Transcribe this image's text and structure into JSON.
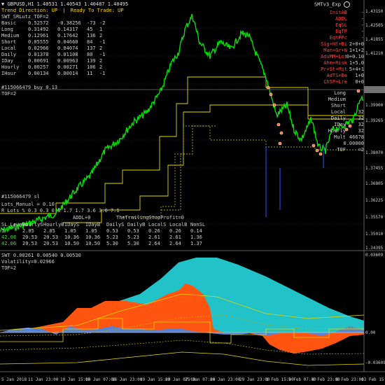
{
  "window": {
    "symbol_line": "GBPUSD,H1  1.40531 1.40543 1.40487 1.40495",
    "expert_label": "SMTv3_Exp",
    "expert_icon": "smiley-icon"
  },
  "status": {
    "trend_direction": "Trend Direction:  UP",
    "ready_to_trade": "Ready To Trade:  UP",
    "separator": "|"
  },
  "left_table": {
    "title": "SWT_SRLutz_TOF=2",
    "rows": [
      {
        "name": "Basic",
        "v1": "0.52572",
        "v2": "-0.38256",
        "v3": "-73",
        "v4": "-2"
      },
      {
        "name": "Long",
        "v1": "0.31492",
        "v2": "0.14317",
        "v3": "45",
        "v4": "1"
      },
      {
        "name": "Medium",
        "v1": "0.12961",
        "v2": "0.17642",
        "v3": "136",
        "v4": "2"
      },
      {
        "name": "Short",
        "v1": "0.05555",
        "v2": "0.04660",
        "v3": "84",
        "v4": "-1"
      },
      {
        "name": "Local",
        "v1": "0.02966",
        "v2": "0.04074",
        "v3": "137",
        "v4": "2"
      },
      {
        "name": "Daily",
        "v1": "0.01378",
        "v2": "0.01108",
        "v3": "80",
        "v4": "-1"
      },
      {
        "name": "IDay",
        "v1": "0.00691",
        "v2": "0.00963",
        "v3": "139",
        "v4": "2"
      },
      {
        "name": "Hourly",
        "v1": "0.00257",
        "v2": "0.00271",
        "v3": "106",
        "v4": "2"
      },
      {
        "name": "IHour",
        "v1": "0.00134",
        "v2": "0.00014",
        "v3": "11",
        "v4": "-1"
      }
    ]
  },
  "right_table": {
    "rows": [
      {
        "label": "InitAB",
        "value": "-"
      },
      {
        "label": "ADDL",
        "value": "-"
      },
      {
        "label": "EqSL",
        "value": "-"
      },
      {
        "label": "EqTP",
        "value": "-"
      },
      {
        "label": "EqtPPc",
        "value": "-"
      },
      {
        "label": "Sig+Hf+Bi",
        "value": "2+0+0"
      },
      {
        "label": "Man+Gr+N",
        "value": "1+1+2"
      },
      {
        "label": "AdvMM+Lot",
        "value": "0+0.10"
      },
      {
        "label": "Ahm+Risk",
        "value": "1+5.0"
      },
      {
        "label": "Pr+St+Mst",
        "value": "5+4+1"
      },
      {
        "label": "AdTS+Be",
        "value": "1+0"
      },
      {
        "label": "ChSP+Lre",
        "value": "0+0"
      }
    ],
    "tf_rows": [
      {
        "label": "Long",
        "value": ""
      },
      {
        "label": "Medium",
        "value": ""
      },
      {
        "label": "Short",
        "value": ""
      },
      {
        "label": "Local",
        "value": "32"
      },
      {
        "label": "Daily",
        "value": "32"
      },
      {
        "label": "IDay",
        "value": "32"
      },
      {
        "label": "Hourly",
        "value": "32"
      },
      {
        "label": "Mult",
        "value": "46678"
      },
      {
        "label": "",
        "value": "0.00000"
      },
      {
        "label": "TOF",
        "value": "=2"
      }
    ]
  },
  "order_line": {
    "text": "#115066479 buy 0.13",
    "tof": "TOF=2"
  },
  "lower_block": {
    "sl_label": "#115066479 sl",
    "lots_manual": "Lots_Manual = 0.10",
    "lots_row": "R_Lots_%  0.3    0.3     0.8     1.7     1.7     3.6     3.6     7.1",
    "addl": "ADDL+0",
    "trailing": "TheTrailingStopProfit=0",
    "header": [
      "SL_Levels",
      "HourlyS",
      "HourlyB",
      "IDayS",
      "IDayB",
      "DailyS",
      "DailyB",
      "LocalS",
      "LocalB",
      "NonSL"
    ],
    "rows": [
      [
        "1",
        "2.05",
        "2.05",
        "1.05",
        "1.05",
        "0.53",
        "0.53",
        "0.26",
        "0.26",
        "0.14"
      ],
      [
        "42.08",
        "20.53",
        "20.53",
        "10.36",
        "10.36",
        "5.23",
        "5.23",
        "2.61",
        "2.61",
        "1.36"
      ],
      [
        "42.06",
        "20.53",
        "20.53",
        "10.50",
        "10.50",
        "5.30",
        "5.30",
        "2.64",
        "2.64",
        "1.37"
      ]
    ]
  },
  "price_axis": {
    "labels": [
      "1.43150",
      "1.42505",
      "1.41855",
      "1.41210",
      "1.40495",
      "1.39900",
      "1.39265",
      "1.38070",
      "1.37455",
      "1.36805",
      "1.36225",
      "1.35570",
      "1.35010",
      "1.34395"
    ],
    "current": "1.40495"
  },
  "oscillator": {
    "title": "SWT 0.00261 0.00540 0.00530",
    "volatility": "Volatility=0.02966",
    "tof": "TOF=2",
    "axis_labels": [
      "0.03609",
      "0.00",
      "-0.03609"
    ]
  },
  "time_axis": {
    "labels": [
      "5 Jan 2018",
      "11 Jan 23:00",
      "10 Jan 15:00",
      "15 Jan 07:00",
      "16 Jan 23:00",
      "19 Jan 15:00",
      "23 Jan 07:00",
      "25 Jan 07:00",
      "26 Jan 23:00",
      "29 Jan 23:00",
      "1 Feb 15:00",
      "5 Feb 07:00",
      "6 Feb 23:00",
      "8 Feb 23:00",
      "13 Feb 15:00"
    ]
  },
  "colors": {
    "background": "#000000",
    "candle": "#00e000",
    "trend_yellow": "#e0e000",
    "cyan_area": "#20c8c8",
    "orange_area": "#ff5a10",
    "blue_area": "#5a82d2",
    "grid_line": "#303030",
    "current_price_line": "#808080"
  }
}
